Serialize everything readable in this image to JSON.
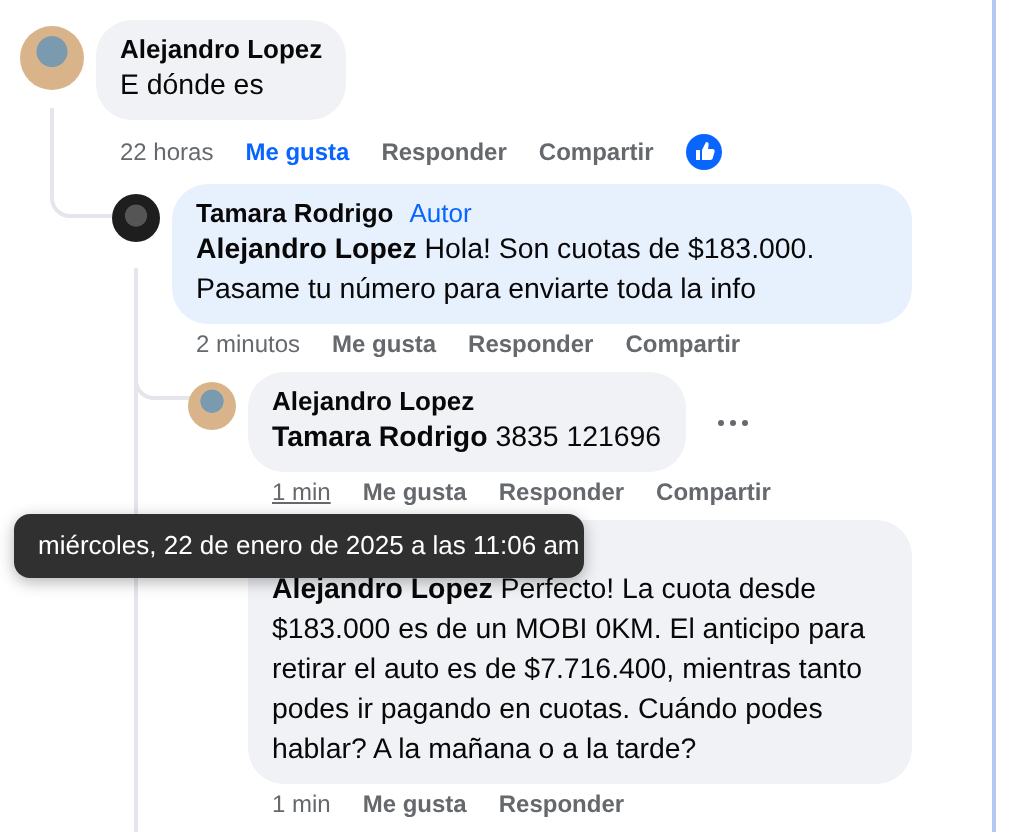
{
  "comments": [
    {
      "author": "Alejandro Lopez",
      "text": "E dónde es",
      "actions": {
        "time": "22 horas",
        "time_hovered": false,
        "like": {
          "label": "Me gusta",
          "selected": true
        },
        "reply": "Responder",
        "share": "Compartir"
      },
      "reaction": true,
      "more_menu": false,
      "children": [
        {
          "author": "Tamara Rodrigo",
          "author_badge": "Autor",
          "text": "**Alejandro Lopez** Hola! Son cuotas de $183.000. Pasame tu número para enviarte toda la info",
          "actions": {
            "time": "2 minutos",
            "time_hovered": false,
            "like": {
              "label": "Me gusta",
              "selected": false
            },
            "reply": "Responder",
            "share": "Compartir"
          },
          "reaction": false,
          "more_menu": false,
          "children": [
            {
              "author": "Alejandro Lopez",
              "text": "**Tamara Rodrigo** 3835 121696",
              "actions": {
                "time": "1 min",
                "time_hovered": true,
                "like": {
                  "label": "Me gusta",
                  "selected": false
                },
                "reply": "Responder",
                "share": "Compartir"
              },
              "reaction": false,
              "more_menu": true
            },
            {
              "text": "**Alejandro Lopez** Perfecto! La cuota desde $183.000 es de un MOBI 0KM. El anticipo para retirar el auto es de $7.716.400, mientras tanto podes ir pagando en cuotas. Cuándo podes hablar? A la mañana o a la tarde?",
              "actions": {
                "time": "1 min",
                "time_hovered": false,
                "like": {
                  "label": "Me gusta",
                  "selected": false
                },
                "reply": "Responder"
              },
              "reaction": false,
              "more_menu": false
            }
          ]
        }
      ]
    }
  ],
  "tooltip": {
    "text": "miércoles, 22 de enero de 2025 a las 11:06 am"
  }
}
